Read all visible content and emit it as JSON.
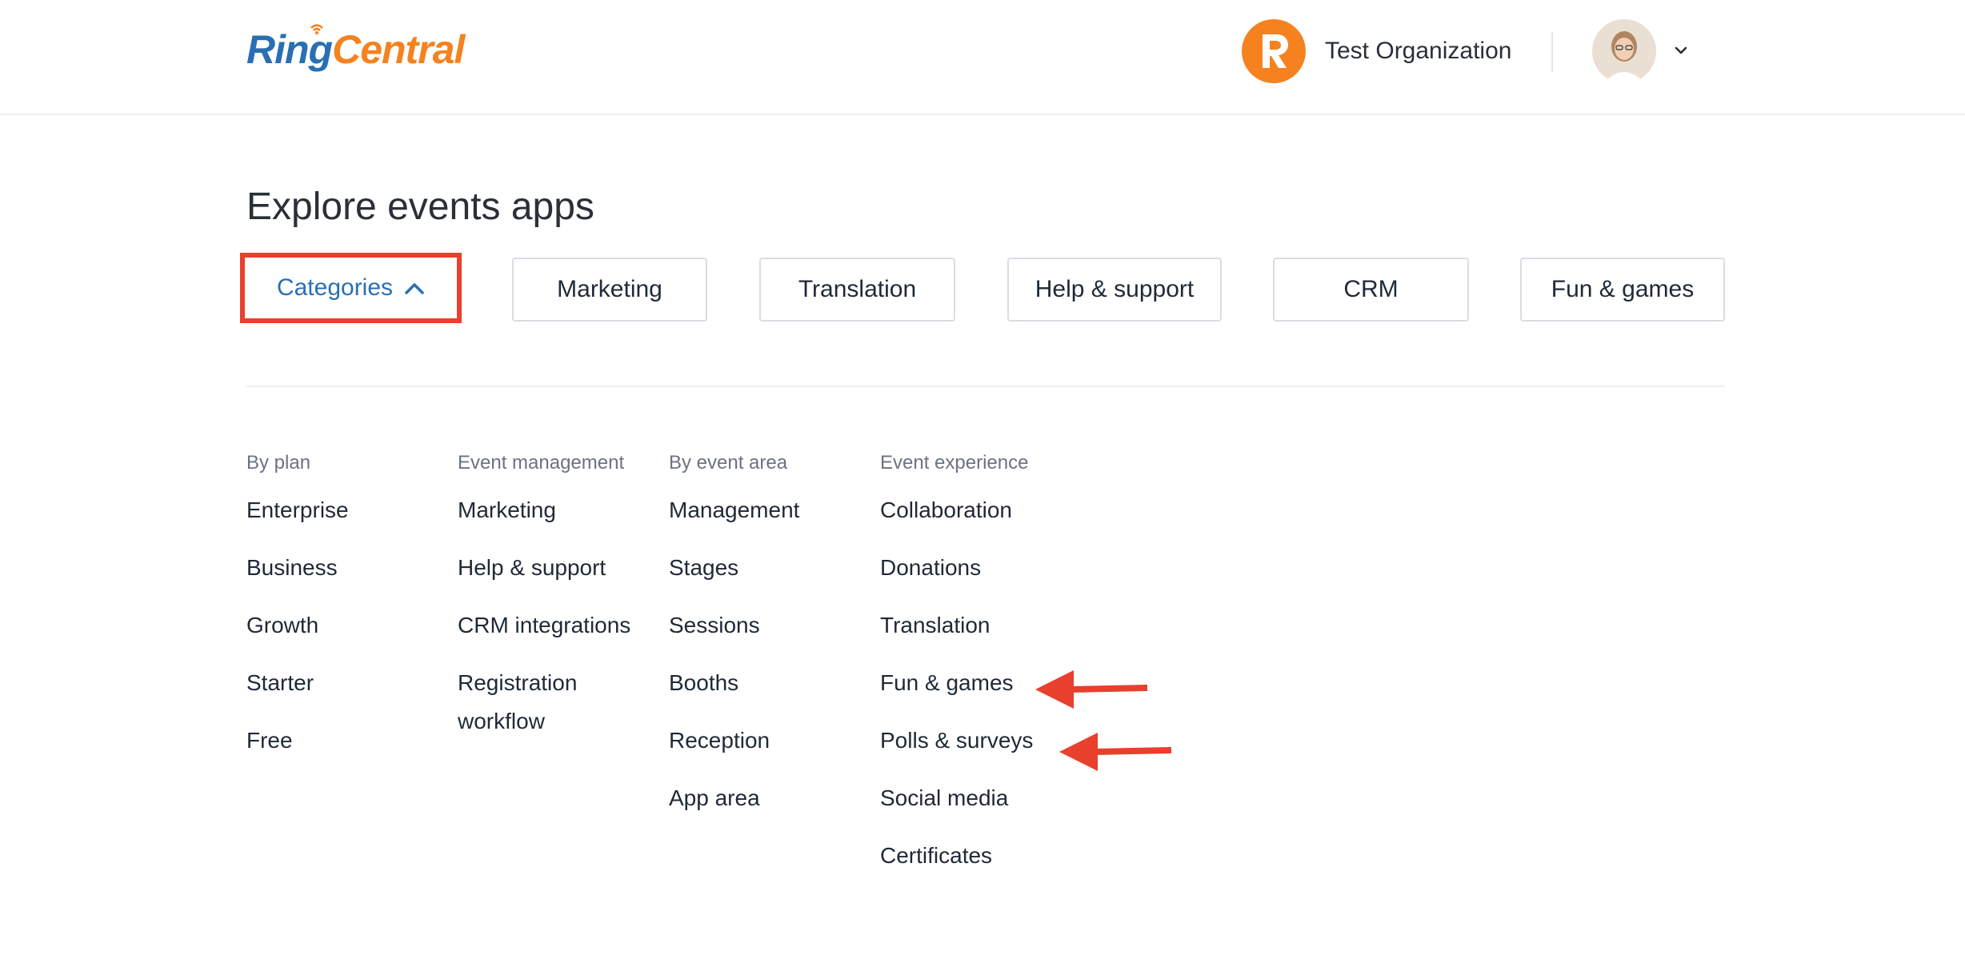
{
  "brand": {
    "logo_part1": "Ring",
    "logo_part2": "Central",
    "colors": {
      "blue": "#2a6fb3",
      "orange": "#f5821f",
      "highlight": "#e8402c"
    }
  },
  "header": {
    "org_name": "Test Organization",
    "org_icon": "r-logo-icon",
    "user_icon": "avatar",
    "menu_icon": "chevron-down-icon"
  },
  "page": {
    "title": "Explore events apps"
  },
  "chips": {
    "categories": "Categories",
    "items": [
      "Marketing",
      "Translation",
      "Help & support",
      "CRM",
      "Fun & games"
    ]
  },
  "columns": [
    {
      "heading": "By plan",
      "items": [
        "Enterprise",
        "Business",
        "Growth",
        "Starter",
        "Free"
      ]
    },
    {
      "heading": "Event management",
      "items": [
        "Marketing",
        "Help & support",
        "CRM integrations",
        "Registration workflow"
      ]
    },
    {
      "heading": "By event area",
      "items": [
        "Management",
        "Stages",
        "Sessions",
        "Booths",
        "Reception",
        "App area"
      ]
    },
    {
      "heading": "Event experience",
      "items": [
        "Collaboration",
        "Donations",
        "Translation",
        "Fun & games",
        "Polls & surveys",
        "Social media",
        "Certificates"
      ]
    }
  ]
}
